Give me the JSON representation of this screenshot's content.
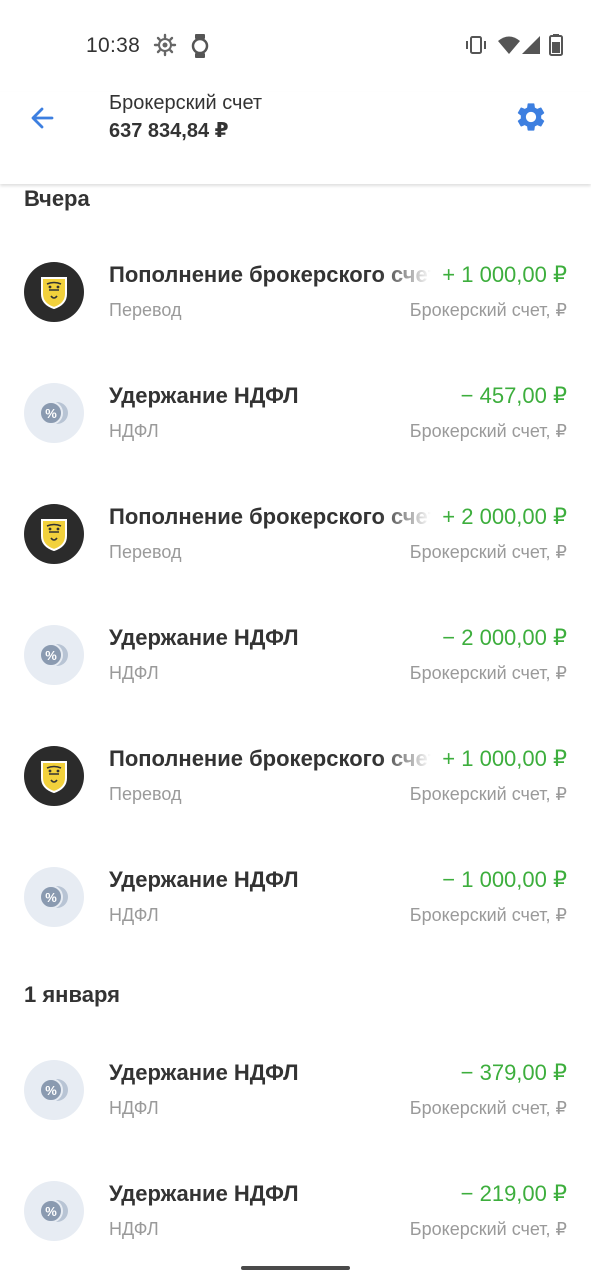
{
  "status_bar": {
    "time": "10:38",
    "icons": [
      "gear-notification-icon",
      "watch-icon",
      "vibrate-icon",
      "wifi-icon",
      "signal-icon",
      "battery-icon"
    ]
  },
  "header": {
    "back_icon": "arrow-left-icon",
    "title": "Брокерский счет",
    "balance": "637 834,84 ₽",
    "settings_icon": "gear-icon",
    "accent_color": "#3d7fe0"
  },
  "colors": {
    "income": "#3dae3d",
    "secondary_text": "#9a9a9a"
  },
  "sections": [
    {
      "label": "Вчера",
      "operations": [
        {
          "icon": "bank-logo-icon",
          "title": "Пополнение брокерского счета",
          "amount": "+ 1 000,00 ₽",
          "category": "Перевод",
          "account": "Брокерский счет, ₽"
        },
        {
          "icon": "tax-icon",
          "title": "Удержание НДФЛ",
          "amount": "− 457,00 ₽",
          "category": "НДФЛ",
          "account": "Брокерский счет, ₽"
        },
        {
          "icon": "bank-logo-icon",
          "title": "Пополнение брокерского счета",
          "amount": "+ 2 000,00 ₽",
          "category": "Перевод",
          "account": "Брокерский счет, ₽"
        },
        {
          "icon": "tax-icon",
          "title": "Удержание НДФЛ",
          "amount": "− 2 000,00 ₽",
          "category": "НДФЛ",
          "account": "Брокерский счет, ₽"
        },
        {
          "icon": "bank-logo-icon",
          "title": "Пополнение брокерского счета",
          "amount": "+ 1 000,00 ₽",
          "category": "Перевод",
          "account": "Брокерский счет, ₽"
        },
        {
          "icon": "tax-icon",
          "title": "Удержание НДФЛ",
          "amount": "− 1 000,00 ₽",
          "category": "НДФЛ",
          "account": "Брокерский счет, ₽"
        }
      ]
    },
    {
      "label": "1 января",
      "operations": [
        {
          "icon": "tax-icon",
          "title": "Удержание НДФЛ",
          "amount": "− 379,00 ₽",
          "category": "НДФЛ",
          "account": "Брокерский счет, ₽"
        },
        {
          "icon": "tax-icon",
          "title": "Удержание НДФЛ",
          "amount": "− 219,00 ₽",
          "category": "НДФЛ",
          "account": "Брокерский счет, ₽"
        }
      ]
    }
  ]
}
